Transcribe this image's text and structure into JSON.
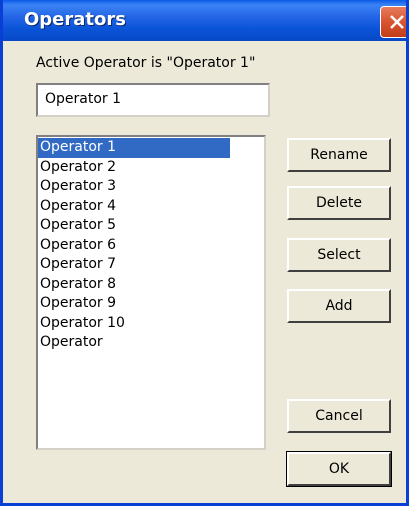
{
  "window": {
    "title": "Operators"
  },
  "dialog": {
    "active_label": "Active Operator is \"Operator 1\"",
    "name_value": "Operator 1",
    "operators": [
      "Operator 1",
      "Operator 2",
      "Operator 3",
      "Operator 4",
      "Operator 5",
      "Operator 6",
      "Operator 7",
      "Operator 8",
      "Operator 9",
      "Operator 10",
      "Operator"
    ],
    "selected_index": 0
  },
  "buttons": {
    "rename": "Rename",
    "delete": "Delete",
    "select": "Select",
    "add": "Add",
    "cancel": "Cancel",
    "ok": "OK"
  },
  "icons": {
    "close": "close-icon"
  },
  "colors": {
    "titlebar": "#0a54d8",
    "selection": "#316ac5",
    "close_button": "#d9542f",
    "dialog_face": "#ece9d8"
  }
}
